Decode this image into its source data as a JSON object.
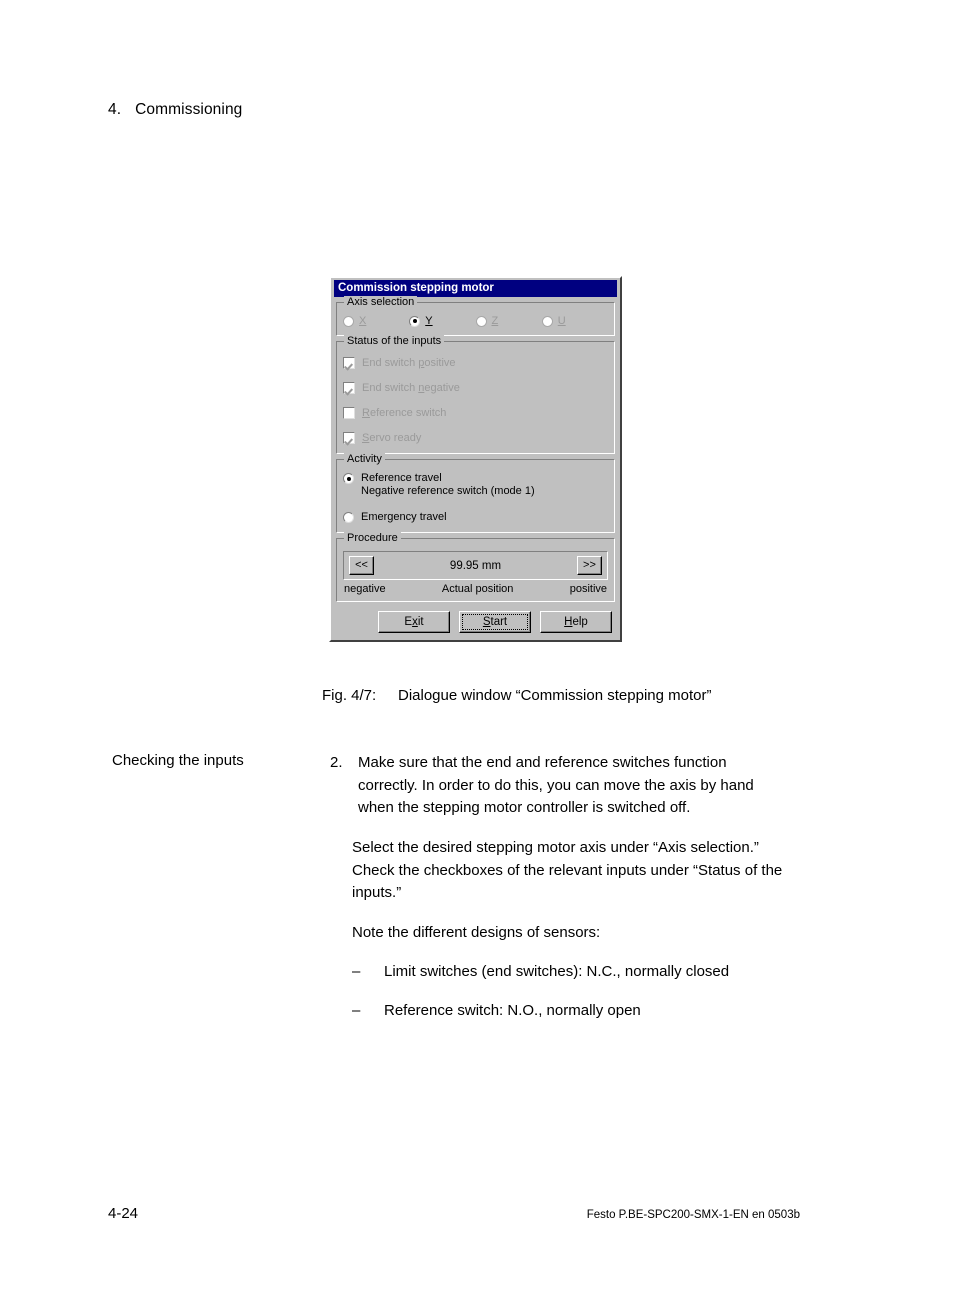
{
  "page": {
    "chapter_number": "4.",
    "chapter_title": "Commissioning",
    "footer_page": "4-24",
    "footer_doc": "Festo  P.BE-SPC200-SMX-1-EN  en 0503b"
  },
  "dialog": {
    "title": "Commission stepping motor",
    "axis_selection": {
      "legend": "Axis selection",
      "options": [
        {
          "label": "X",
          "mnemonic": "X",
          "selected": false,
          "enabled": false
        },
        {
          "label": "Y",
          "mnemonic": "Y",
          "selected": true,
          "enabled": true
        },
        {
          "label": "Z",
          "mnemonic": "Z",
          "selected": false,
          "enabled": false
        },
        {
          "label": "U",
          "mnemonic": "U",
          "selected": false,
          "enabled": false
        }
      ]
    },
    "status_of_inputs": {
      "legend": "Status of the inputs",
      "items": [
        {
          "label_before": "End switch ",
          "mnemonic": "p",
          "label_after": "ositive",
          "checked": true,
          "enabled": false
        },
        {
          "label_before": "End switch ",
          "mnemonic": "n",
          "label_after": "egative",
          "checked": true,
          "enabled": false
        },
        {
          "label_before": "",
          "mnemonic": "R",
          "label_after": "eference switch",
          "checked": false,
          "enabled": false
        },
        {
          "label_before": "",
          "mnemonic": "S",
          "label_after": "ervo ready",
          "checked": true,
          "enabled": false
        }
      ]
    },
    "activity": {
      "legend": "Activity",
      "options": [
        {
          "label": "Reference travel",
          "sublabel": "Negative reference switch (mode 1)",
          "selected": true
        },
        {
          "label": "Emergency travel",
          "sublabel": "",
          "selected": false
        }
      ]
    },
    "procedure": {
      "legend": "Procedure",
      "prev_button": "<<",
      "next_button": ">>",
      "position_value": "99.95 mm",
      "label_left": "negative",
      "label_center": "Actual position",
      "label_right": "positive"
    },
    "buttons": [
      {
        "before": "E",
        "mnemonic": "x",
        "after": "it",
        "focused": false
      },
      {
        "before": "",
        "mnemonic": "S",
        "after": "tart",
        "focused": true
      },
      {
        "before": "",
        "mnemonic": "H",
        "after": "elp",
        "focused": false
      }
    ],
    "colors": {
      "titlebar": "#000080",
      "face": "#c0c0c0",
      "disabled_text": "#9a9a9a"
    }
  },
  "figure": {
    "number": "Fig. 4/7:",
    "caption": "Dialogue window “Commission stepping motor”"
  },
  "content": {
    "margin_note": "Checking the inputs",
    "step_marker": "2.",
    "step_text": "Make sure that the end and reference switches function correctly. In order to do this, you can move the axis by hand when the stepping motor controller is switched off.",
    "paragraph_2": "Select the desired stepping motor axis under “Axis selection.” Check the checkboxes of the relevant inputs under “Status of the inputs.”",
    "paragraph_3": "Note the different designs of sensors:",
    "bullets": [
      {
        "marker": "–",
        "text": "Limit switches (end switches): N.C., normally closed"
      },
      {
        "marker": "–",
        "text": "Reference switch: N.O., normally open"
      }
    ]
  }
}
